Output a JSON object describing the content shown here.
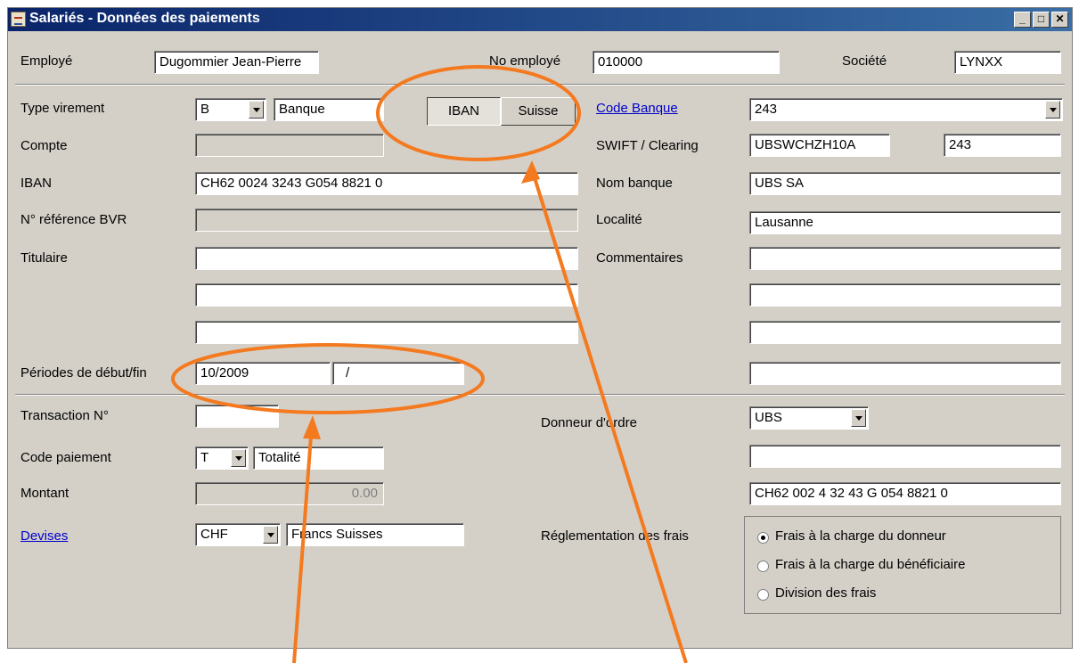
{
  "window": {
    "title": "Salariés - Données des paiements"
  },
  "header": {
    "employe_label": "Employé",
    "employe_value": "Dugommier Jean-Pierre",
    "no_employe_label": "No employé",
    "no_employe_value": "010000",
    "societe_label": "Société",
    "societe_value": "LYNXX"
  },
  "bank": {
    "type_virement_label": "Type virement",
    "type_virement_code": "B",
    "type_virement_value": "Banque",
    "iban_button": "IBAN",
    "suisse_button": "Suisse",
    "code_banque_label": "Code Banque",
    "code_banque_value": "243",
    "compte_label": "Compte",
    "swift_label": "SWIFT / Clearing",
    "swift_value": "UBSWCHZH10A",
    "clearing_value": "243",
    "iban_label": "IBAN",
    "iban_value": "CH62 0024 3243 G054 8821 0",
    "nom_banque_label": "Nom banque",
    "nom_banque_value": "UBS SA",
    "bvr_label": "N° référence BVR",
    "localite_label": "Localité",
    "localite_value": "Lausanne",
    "titulaire_label": "Titulaire",
    "commentaires_label": "Commentaires",
    "periodes_label": "Périodes de début/fin",
    "periode_debut": "10/2009",
    "periode_fin": "/"
  },
  "payment": {
    "transaction_label": "Transaction N°",
    "donneur_label": "Donneur d'ordre",
    "donneur_value": "UBS",
    "code_paiement_label": "Code paiement",
    "code_paiement_code": "T",
    "code_paiement_value": "Totalité",
    "montant_label": "Montant",
    "montant_value": "0.00",
    "donneur_iban_value": "CH62  002 4 32 43 G 054  8821  0",
    "devises_label": "Devises",
    "devise_code": "CHF",
    "devise_value": "Francs Suisses",
    "frais_label": "Réglementation des frais",
    "frais_options": [
      "Frais à la charge du donneur",
      "Frais à la charge du bénéficiaire",
      "Division des frais"
    ],
    "frais_selected": 0
  },
  "colors": {
    "annotation": "#f47a20",
    "titlebar": "#0a246a",
    "link": "#0000cc"
  }
}
